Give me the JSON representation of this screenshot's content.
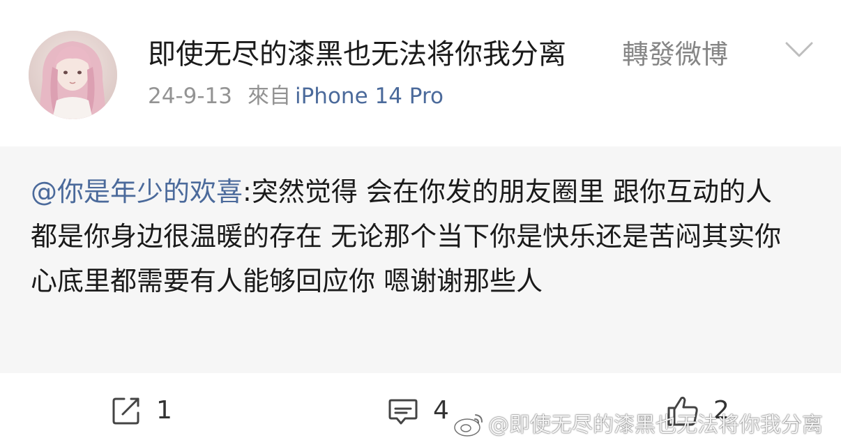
{
  "post": {
    "author": "即使无尽的漆黑也无法将你我分离",
    "repost_label": "轉發微博",
    "date": "24-9-13",
    "source_prefix": "來自",
    "device": "iPhone 14 Pro"
  },
  "repost": {
    "mention": "@你是年少的欢喜",
    "text": ":突然觉得 会在你发的朋友圈里 跟你互动的人都是你身边很温暖的存在 无论那个当下你是快乐还是苦闷其实你心底里都需要有人能够回应你 嗯谢谢那些人"
  },
  "actions": {
    "repost_count": "1",
    "comment_count": "4",
    "like_count": "2"
  },
  "watermark": "@即使无尽的漆黑也无法将你我分离",
  "icons": {
    "chevron": "chevron-down-icon",
    "repost": "share-edit-icon",
    "comment": "comment-icon",
    "like": "thumbs-up-icon",
    "weibo": "weibo-logo-icon"
  },
  "colors": {
    "link": "#4b6a9b",
    "meta": "#939393",
    "panel": "#f6f6f6"
  }
}
